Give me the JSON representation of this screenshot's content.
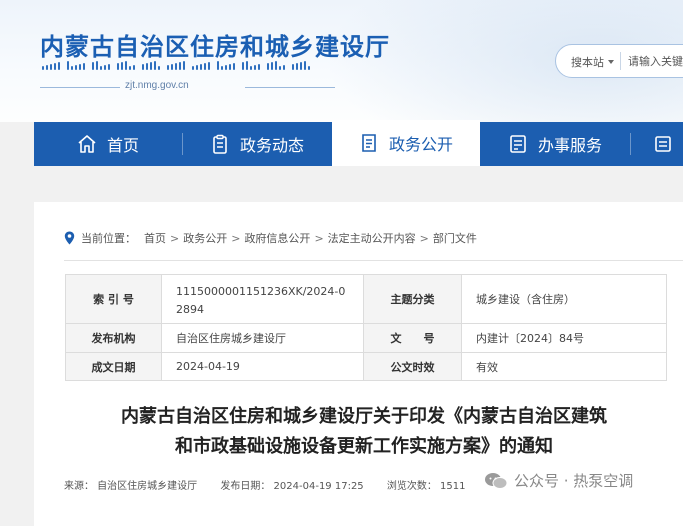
{
  "header": {
    "site_name": "内蒙古自治区住房和城乡建设厅",
    "domain": "zjt.nmg.gov.cn",
    "search": {
      "scope_label": "搜本站",
      "placeholder": "请输入关键"
    }
  },
  "nav": {
    "items": [
      {
        "label": "首页",
        "icon": "home-icon"
      },
      {
        "label": "政务动态",
        "icon": "clipboard-icon"
      },
      {
        "label": "政务公开",
        "icon": "document-icon"
      },
      {
        "label": "办事服务",
        "icon": "service-icon"
      },
      {
        "label": "",
        "icon": "more-icon"
      }
    ],
    "active_index": 2,
    "colors": {
      "bar": "#1c5eb0",
      "active_bg": "#ffffff"
    }
  },
  "breadcrumb": {
    "prefix": "当前位置：",
    "items": [
      "首页",
      "政务公开",
      "政府信息公开",
      "法定主动公开内容",
      "部门文件"
    ],
    "separator": ">"
  },
  "meta_table": {
    "index_label": "索 引 号",
    "index_value": "1115000001151236XK/2024-02894",
    "category_label": "主题分类",
    "category_value": "城乡建设（含住房）",
    "publisher_label": "发布机构",
    "publisher_value": "自治区住房城乡建设厅",
    "doc_no_label": "文　　号",
    "doc_no_value": "内建计〔2024〕84号",
    "date_label": "成文日期",
    "date_value": "2024-04-19",
    "validity_label": "公文时效",
    "validity_value": "有效"
  },
  "article": {
    "title_line1": "内蒙古自治区住房和城乡建设厅关于印发《内蒙古自治区建筑",
    "title_line2": "和市政基础设施设备更新工作实施方案》的通知",
    "source": "来源：  自治区住房城乡建设厅",
    "published": "发布日期：  2024-04-19 17:25",
    "views": "浏览次数：  1511"
  },
  "watermark": {
    "text": "公众号 · 热泵空调"
  }
}
